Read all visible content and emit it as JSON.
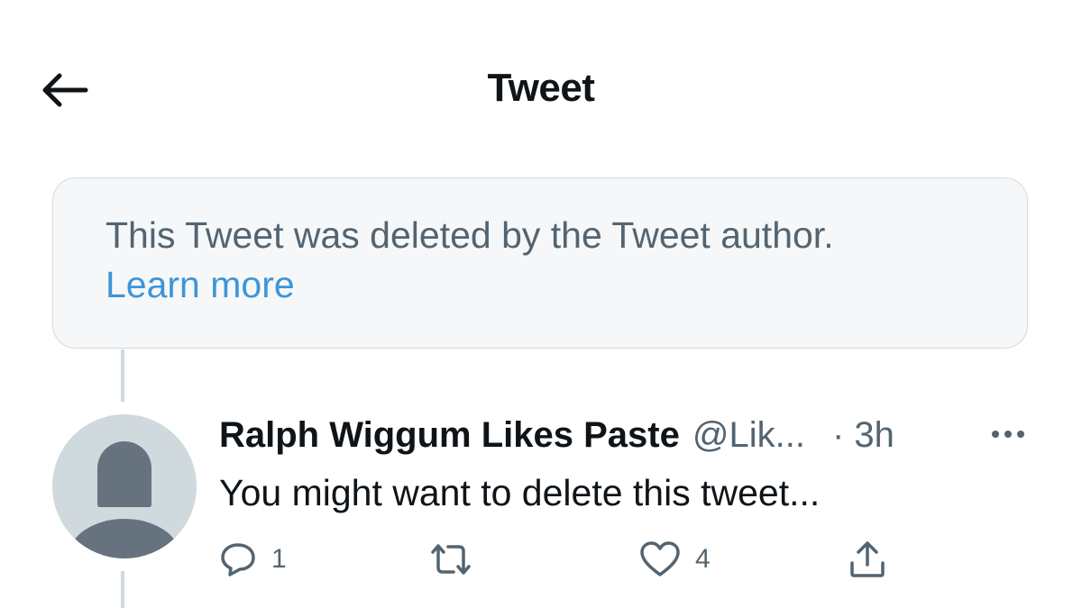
{
  "header": {
    "title": "Tweet",
    "back_icon": "back-arrow-icon"
  },
  "deleted_notice": {
    "text": "This Tweet was deleted by the Tweet author.",
    "link_label": "Learn more"
  },
  "reply": {
    "author_name": "Ralph Wiggum Likes Paste",
    "author_handle": "@Lik...",
    "time": "· 3h",
    "body": "You might want to delete this tweet...",
    "more_icon": "more-horizontal-icon",
    "avatar": "default-avatar",
    "actions": {
      "reply_count": "1",
      "retweet_count": "",
      "like_count": "4"
    }
  },
  "colors": {
    "text_primary": "#0f1419",
    "text_secondary": "#536471",
    "link": "#3e95d8",
    "notice_bg": "#f5f7f8",
    "notice_border": "#d4dade",
    "thread_line": "#cfd9de",
    "avatar_bg": "#cfd9de",
    "avatar_fg": "#66737f"
  }
}
